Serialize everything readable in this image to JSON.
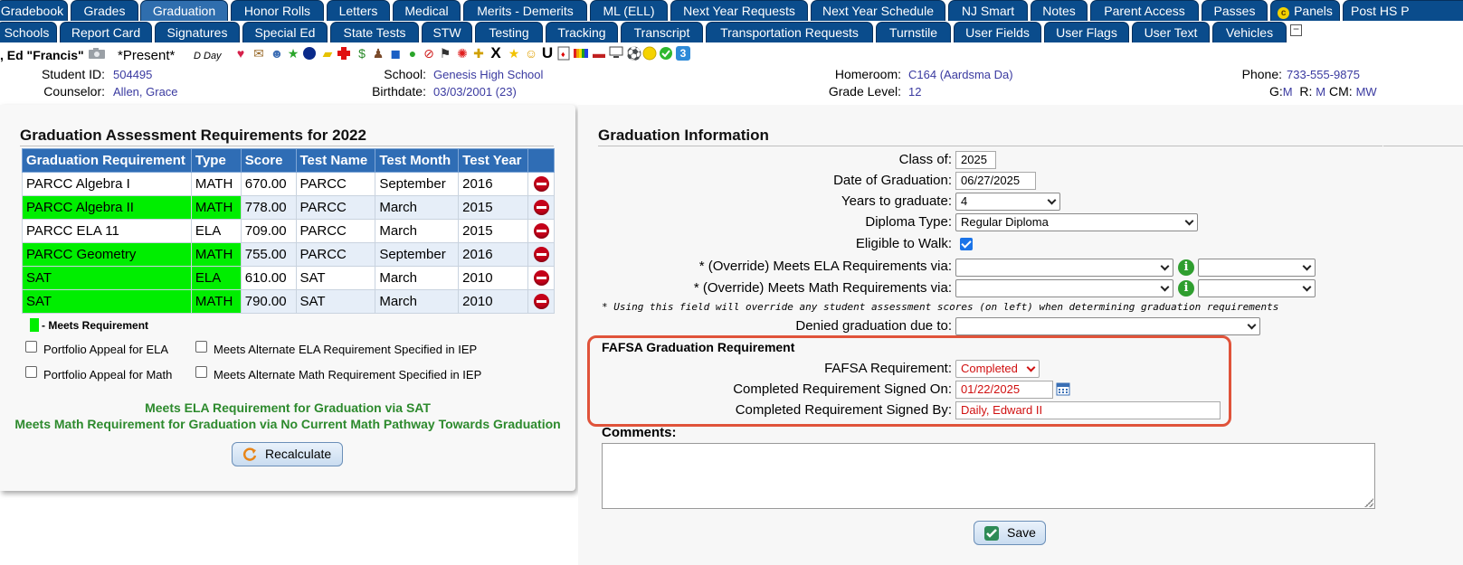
{
  "tabs_row1": [
    {
      "label": "Gradebook"
    },
    {
      "label": "Grades"
    },
    {
      "label": "Graduation"
    },
    {
      "label": "Honor Rolls"
    },
    {
      "label": "Letters"
    },
    {
      "label": "Medical"
    },
    {
      "label": "Merits - Demerits"
    },
    {
      "label": "ML (ELL)"
    },
    {
      "label": "Next Year Requests"
    },
    {
      "label": "Next Year Schedule"
    },
    {
      "label": "NJ Smart"
    },
    {
      "label": "Notes"
    },
    {
      "label": "Parent Access"
    },
    {
      "label": "Passes"
    },
    {
      "label": "Panels"
    },
    {
      "label": "Post HS P"
    }
  ],
  "tabs_row2": [
    {
      "label": "Schools"
    },
    {
      "label": "Report Card"
    },
    {
      "label": "Signatures"
    },
    {
      "label": "Special Ed"
    },
    {
      "label": "State Tests"
    },
    {
      "label": "STW"
    },
    {
      "label": "Testing"
    },
    {
      "label": "Tracking"
    },
    {
      "label": "Transcript"
    },
    {
      "label": "Transportation Requests"
    },
    {
      "label": "Turnstile"
    },
    {
      "label": "User Fields"
    },
    {
      "label": "User Flags"
    },
    {
      "label": "User Text"
    },
    {
      "label": "Vehicles"
    }
  ],
  "active_tab": "Graduation",
  "tab_toggle_symbol": "−",
  "student": {
    "name": ", Ed \"Francis\"",
    "status": "*Present*",
    "day": "D Day",
    "flags_badge_number": "3",
    "student_id_label": "Student ID:",
    "student_id": "504495",
    "counselor_label": "Counselor:",
    "counselor": "Allen, Grace",
    "school_label": "School:",
    "school": "Genesis High School",
    "birthdate_label": "Birthdate:",
    "birthdate": "03/03/2001 (23)",
    "homeroom_label": "Homeroom:",
    "homeroom": "C164 (Aardsma Da)",
    "grade_level_label": "Grade Level:",
    "grade_level": "12",
    "phone_label": "Phone:",
    "phone": "733-555-9875",
    "g_label": "G:",
    "g_value": "M",
    "r_label": "R:",
    "r_value": "M",
    "cm_label": "CM:",
    "cm_value": "MW"
  },
  "assessment": {
    "title": "Graduation Assessment Requirements for 2022",
    "columns": [
      "Graduation Requirement",
      "Type",
      "Score",
      "Test Name",
      "Test Month",
      "Test Year"
    ],
    "rows": [
      {
        "requirement": "PARCC Algebra I",
        "type": "MATH",
        "score": "670.00",
        "test_name": "PARCC",
        "month": "September",
        "year": "2016",
        "meets": false
      },
      {
        "requirement": "PARCC Algebra II",
        "type": "MATH",
        "score": "778.00",
        "test_name": "PARCC",
        "month": "March",
        "year": "2015",
        "meets": true
      },
      {
        "requirement": "PARCC ELA 11",
        "type": "ELA",
        "score": "709.00",
        "test_name": "PARCC",
        "month": "March",
        "year": "2015",
        "meets": false
      },
      {
        "requirement": "PARCC Geometry",
        "type": "MATH",
        "score": "755.00",
        "test_name": "PARCC",
        "month": "September",
        "year": "2016",
        "meets": true
      },
      {
        "requirement": "SAT",
        "type": "ELA",
        "score": "610.00",
        "test_name": "SAT",
        "month": "March",
        "year": "2010",
        "meets": true
      },
      {
        "requirement": "SAT",
        "type": "MATH",
        "score": "790.00",
        "test_name": "SAT",
        "month": "March",
        "year": "2010",
        "meets": true
      }
    ],
    "legend_label": "- Meets Requirement",
    "meets_color": "#00ee00",
    "checkboxes": {
      "portfolio_ela": "Portfolio Appeal for ELA",
      "alt_ela": "Meets Alternate ELA Requirement Specified in IEP",
      "portfolio_math": "Portfolio Appeal for Math",
      "alt_math": "Meets Alternate Math Requirement Specified in IEP"
    },
    "ela_message": "Meets ELA Requirement for Graduation via SAT",
    "math_message": "Meets Math Requirement for Graduation via No Current Math Pathway Towards Graduation",
    "recalculate_label": "Recalculate"
  },
  "grad_info": {
    "title": "Graduation Information",
    "class_of_label": "Class of:",
    "class_of": "2025",
    "date_label": "Date of Graduation:",
    "date": "06/27/2025",
    "years_label": "Years to graduate:",
    "years": "4",
    "diploma_label": "Diploma Type:",
    "diploma": "Regular Diploma",
    "eligible_label": "Eligible to Walk:",
    "eligible_checked": true,
    "override_ela_label": "* (Override) Meets ELA Requirements via:",
    "override_math_label": "* (Override) Meets Math Requirements via:",
    "override_note": "* Using this field will override any student assessment scores (on left) when determining graduation requirements",
    "denied_label": "Denied graduation due to:",
    "fafsa_title": "FAFSA Graduation Requirement",
    "fafsa_req_label": "FAFSA Requirement:",
    "fafsa_req": "Completed",
    "signed_on_label": "Completed Requirement Signed On:",
    "signed_on": "01/22/2025",
    "signed_by_label": "Completed Requirement Signed By:",
    "signed_by": "Daily, Edward II",
    "comments_label": "Comments:",
    "save_label": "Save"
  },
  "colors": {
    "tab_bg": "#0a4c8c",
    "table_header": "#2f6db5",
    "highlight_border": "#e0533a",
    "message_green": "#2d8a2d",
    "field_red": "#d01010"
  }
}
